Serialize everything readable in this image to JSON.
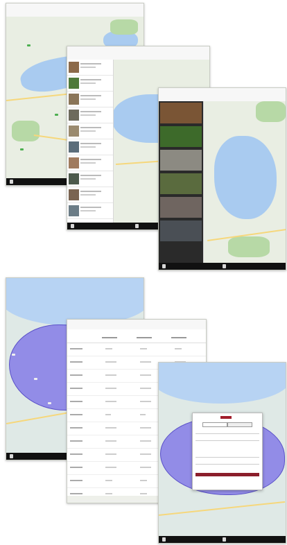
{
  "screens": [
    {
      "id": "map-overview",
      "status_time": "",
      "nav_title": "",
      "tabs": [],
      "toolbar_icons": [
        "map-icon"
      ]
    },
    {
      "id": "map-with-list",
      "nav_title": "",
      "toolbar_icons": [
        "map-icon",
        "list-icon"
      ]
    },
    {
      "id": "map-with-photos",
      "nav_title": "",
      "toolbar_icons": [
        "map-icon",
        "photo-icon"
      ]
    },
    {
      "id": "polygon-map",
      "nav_title": "",
      "toolbar_icons": [
        "map-icon"
      ]
    },
    {
      "id": "stats-table",
      "nav_title": "",
      "toolbar_icons": [
        "chart-icon"
      ]
    },
    {
      "id": "login-modal",
      "nav_title": "",
      "toolbar_icons": [
        "map-icon",
        "list-icon"
      ]
    }
  ],
  "colors": {
    "water": "#a9cbf0",
    "park": "#b7d9a6",
    "road": "#f6d77b",
    "polygon": "#7468e8",
    "accent": "#2f7cf6",
    "brand": "#8b1e2b",
    "toolbar": "#111111"
  }
}
